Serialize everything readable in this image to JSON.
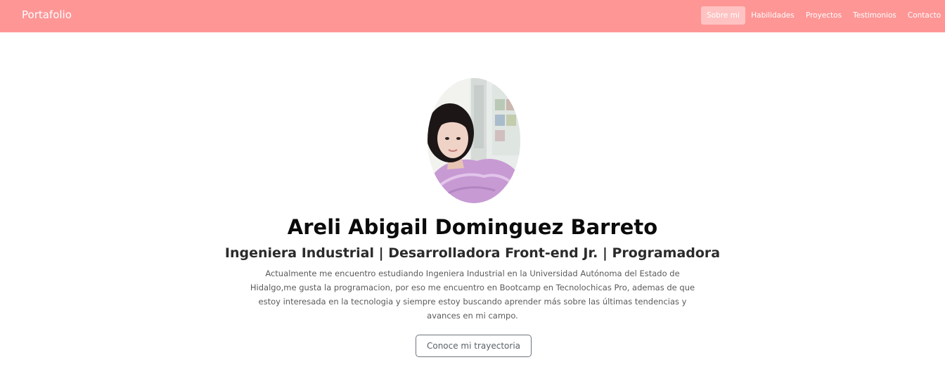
{
  "navbar": {
    "brand": "Portafolio",
    "items": [
      {
        "label": "Sobre mi",
        "active": true
      },
      {
        "label": "Habilidades",
        "active": false
      },
      {
        "label": "Proyectos",
        "active": false
      },
      {
        "label": "Testimonios",
        "active": false
      },
      {
        "label": "Contacto",
        "active": false
      }
    ]
  },
  "hero": {
    "name": "Areli Abigail Dominguez Barreto",
    "subtitle": "Ingeniera Industrial | Desarrolladora Front-end Jr. | Programadora",
    "bio_lines": [
      "Actualmente me encuentro estudiando Ingeniera Industrial en la Universidad Autónoma del Estado de",
      "Hidalgo,me gusta la programacion, por eso me encuentro en Bootcamp en Tecnolochicas Pro, ademas de que",
      "estoy interesada en la tecnologia y siempre estoy buscando aprender más sobre las últimas tendencias y",
      "avances en mi campo."
    ],
    "cta_label": "Conoce mi trayectoria"
  },
  "colors": {
    "navbar_bg": "#fe9696",
    "nav_active_bg": "#ffc2c2",
    "text_dark": "#0b0b0b",
    "button_border": "#6c757d"
  }
}
